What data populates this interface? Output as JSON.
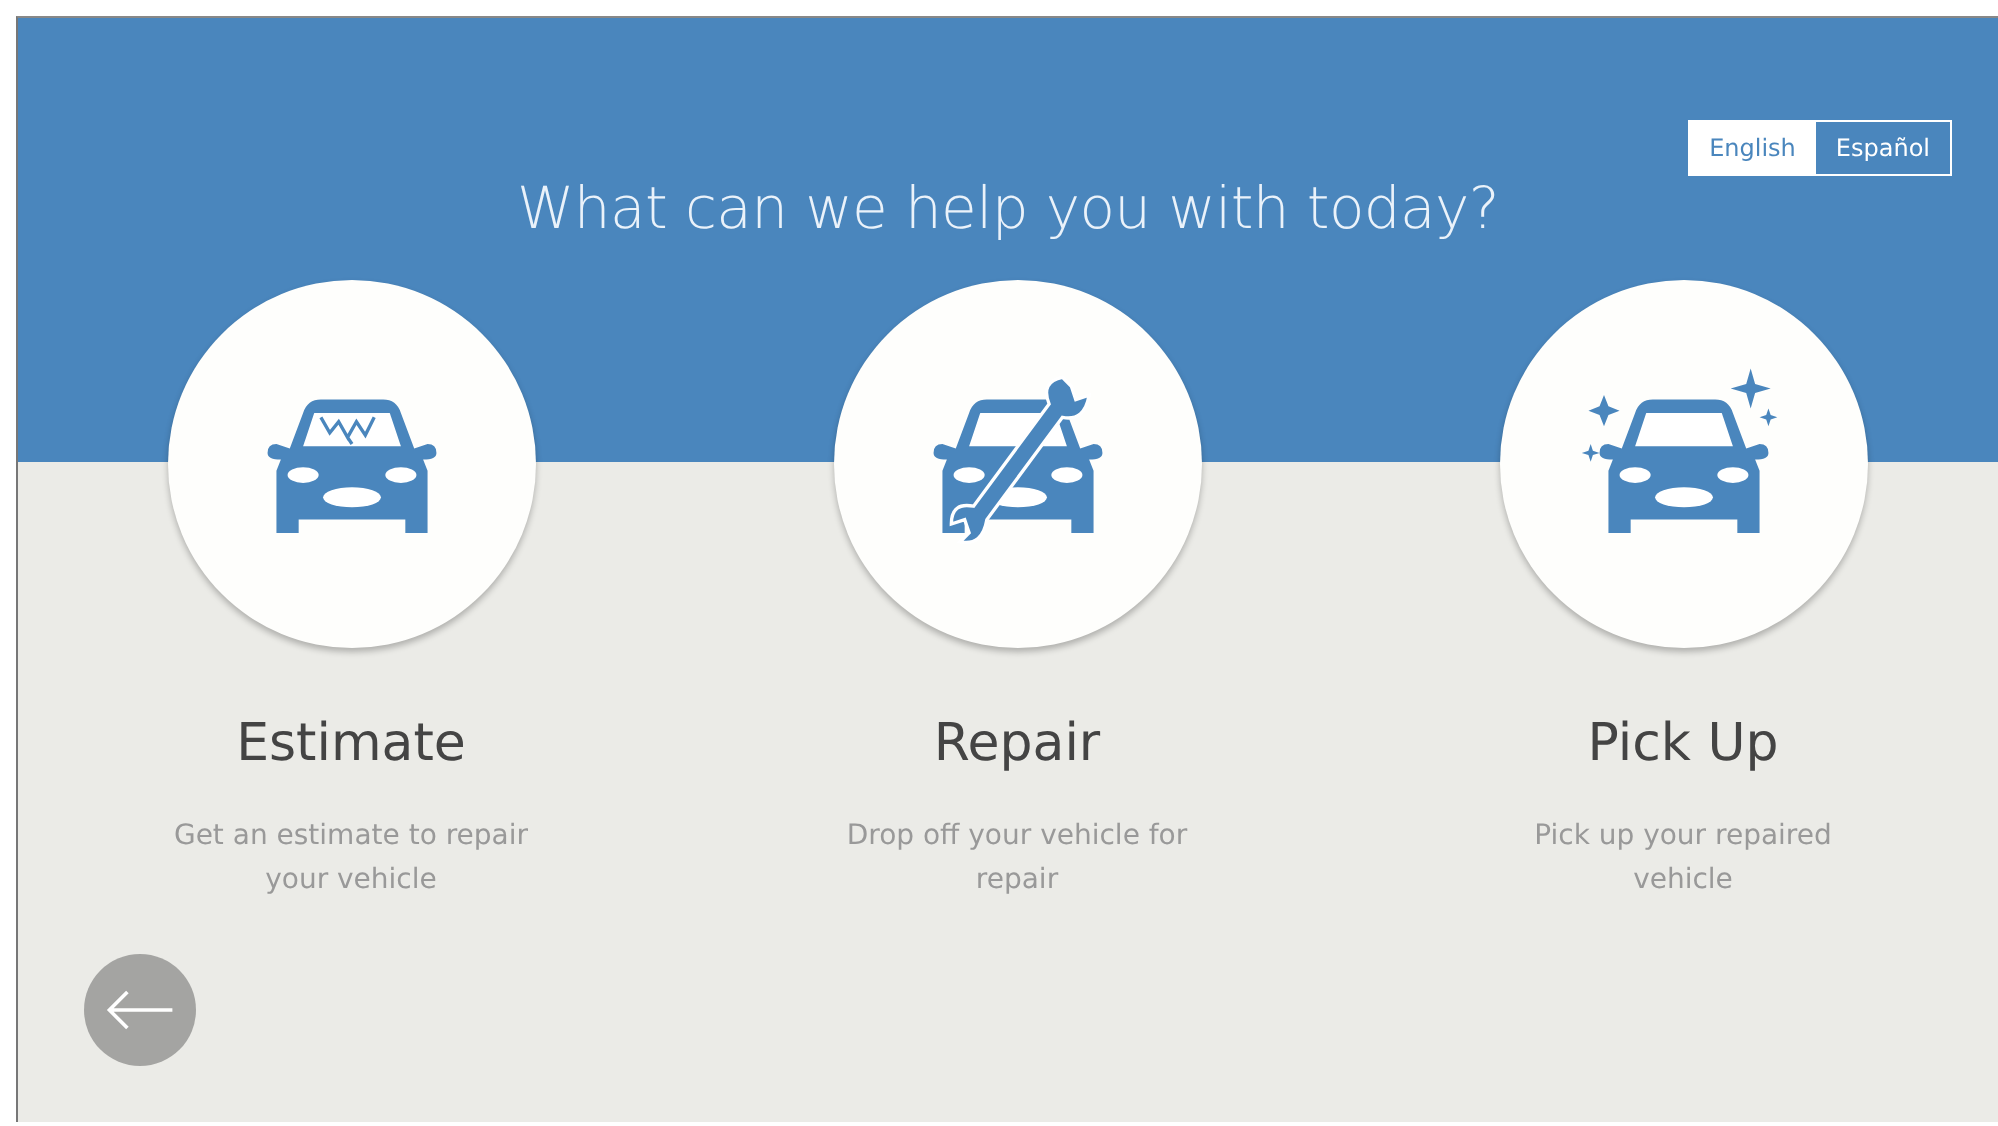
{
  "languages": [
    {
      "label": "English",
      "selected": true
    },
    {
      "label": "Español",
      "selected": false
    }
  ],
  "heading": "What can we help you with today?",
  "options": [
    {
      "kind": "estimate",
      "title": "Estimate",
      "description": "Get an estimate to repair your vehicle"
    },
    {
      "kind": "repair",
      "title": "Repair",
      "description": "Drop off your vehicle for repair"
    },
    {
      "kind": "pickup",
      "title": "Pick Up",
      "description": "Pick up your repaired vehicle"
    }
  ],
  "back_button": {
    "kind": "back"
  }
}
